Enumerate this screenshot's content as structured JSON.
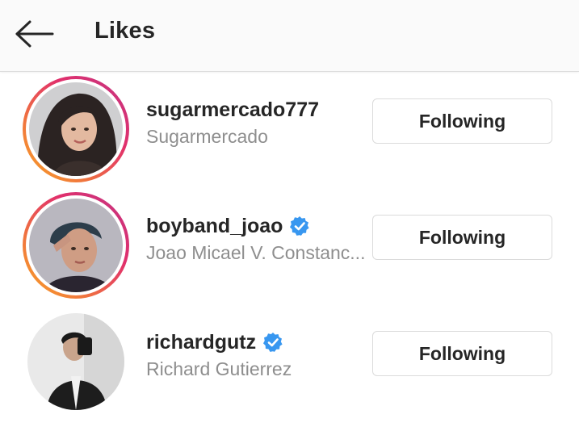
{
  "header": {
    "title": "Likes",
    "back_icon": "arrow-left-icon"
  },
  "colors": {
    "text_primary": "#262626",
    "text_secondary": "#8e8e8e",
    "verified_blue": "#3897f0",
    "button_border": "#dbdbdb",
    "header_bg": "#fafafa"
  },
  "likes": [
    {
      "username": "sugarmercado777",
      "full_name": "Sugarmercado",
      "verified": false,
      "has_story": true,
      "button_label": "Following"
    },
    {
      "username": "boyband_joao",
      "full_name": "Joao Micael V. Constanc...",
      "verified": true,
      "has_story": true,
      "button_label": "Following"
    },
    {
      "username": "richardgutz",
      "full_name": "Richard Gutierrez",
      "verified": true,
      "has_story": false,
      "button_label": "Following"
    }
  ]
}
